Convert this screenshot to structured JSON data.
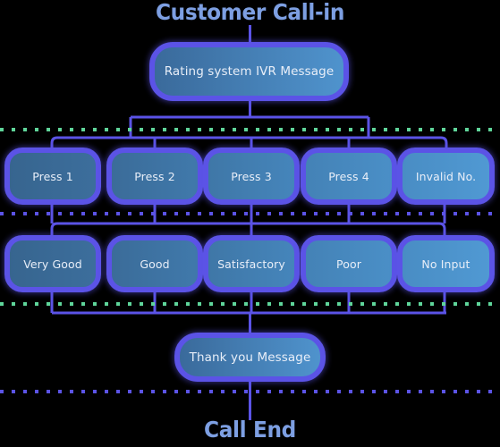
{
  "diagram": {
    "title_top": "Customer Call-in",
    "title_bottom": "Call End",
    "accent_border": "#5b53e6",
    "title_color": "#7d9fe2",
    "dotted_green": "#5fd59a",
    "dotted_blue": "#5b53e6",
    "background": "#000000"
  },
  "nodes": {
    "ivr": {
      "label": "Rating system IVR Message"
    },
    "thanks": {
      "label": "Thank you Message"
    }
  },
  "press_row": {
    "items": [
      {
        "label": "Press 1"
      },
      {
        "label": "Press 2"
      },
      {
        "label": "Press 3"
      },
      {
        "label": "Press 4"
      },
      {
        "label": "Invalid No."
      }
    ]
  },
  "rating_row": {
    "items": [
      {
        "label": "Very Good"
      },
      {
        "label": "Good"
      },
      {
        "label": "Satisfactory"
      },
      {
        "label": "Poor"
      },
      {
        "label": "No Input"
      }
    ]
  },
  "dividers": [
    {
      "name": "divider-top",
      "style": "green"
    },
    {
      "name": "divider-mid-upper",
      "style": "blue"
    },
    {
      "name": "divider-mid-lower",
      "style": "green"
    },
    {
      "name": "divider-bottom",
      "style": "blue"
    }
  ]
}
